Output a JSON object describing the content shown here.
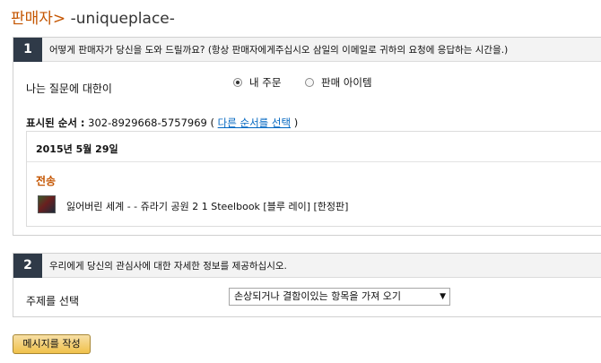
{
  "header": {
    "seller_label": "판매자>",
    "seller_name": "-uniqueplace-"
  },
  "section1": {
    "number": "1",
    "title": "어떻게 판매자가 당신을 도와 드릴까요? (항상 판매자에게주십시오 삼일의 이메일로 귀하의 요청에 응답하는 시간을.)",
    "question_label": "나는 질문에 대한이",
    "radio_options": [
      {
        "label": "내 주문",
        "selected": true
      },
      {
        "label": "판매 아이템",
        "selected": false
      }
    ],
    "order_label": "표시된 순서 :",
    "order_number": "302-8929668-5757969",
    "order_paren_open": "(",
    "change_order_link": "다른 순서를 선택",
    "order_paren_close": ")",
    "order_date": "2015년 5월 29일",
    "shipping_label": "전송",
    "item_title": "잃어버린 세계 - - 쥬라기 공원 2 1 Steelbook [블루 레이] [한정판]"
  },
  "section2": {
    "number": "2",
    "title": "우리에게 당신의 관심사에 대한 자세한 정보를 제공하십시오.",
    "topic_label": "주제를 선택",
    "topic_selected": "손상되거나 결함이있는 항목을 가져 오기"
  },
  "actions": {
    "write_message": "메시지를 작성"
  },
  "colors": {
    "accent": "#c45500",
    "link": "#0066c0",
    "section_number_bg": "#2f3a48",
    "button_gold": "#f0c14b"
  }
}
